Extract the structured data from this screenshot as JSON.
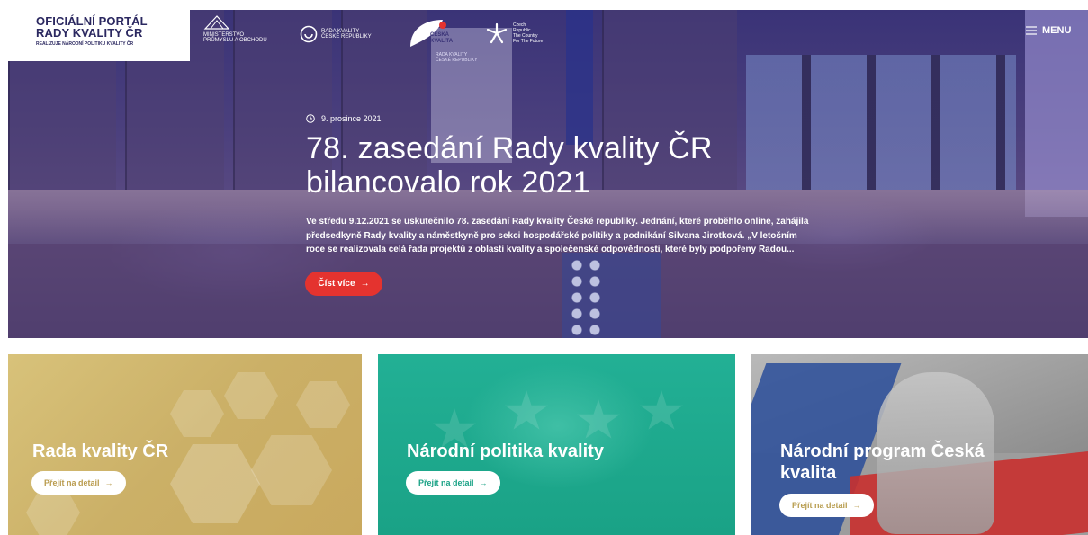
{
  "header": {
    "logo_title_line1": "OFICIÁLNÍ PORTÁL",
    "logo_title_line2": "RADY KVALITY ČR",
    "logo_subtitle": "REALIZUJE NÁRODNÍ POLITIKU KVALITY ČR",
    "partners": {
      "mpo_line1": "MINISTERSTVO",
      "mpo_line2": "PRŮMYSLU A OBCHODU",
      "rada_line1": "RADA KVALITY",
      "rada_line2": "ČESKÉ REPUBLIKY",
      "ck_line1": "ČESKÁ",
      "ck_line2": "KVALITA",
      "czech_line1": "Czech",
      "czech_line2": "Republic",
      "czech_line3": "The Country",
      "czech_line4": "For The Future"
    },
    "menu_label": "MENU",
    "banner_line1": "RADA KVALITY",
    "banner_line2": "ČESKÉ REPUBLIKY"
  },
  "hero": {
    "date": "9. prosince 2021",
    "headline": "78. zasedání Rady kvality ČR bilancovalo rok 2021",
    "lead": "Ve středu 9.12.2021 se uskutečnilo 78. zasedání Rady kvality České republiky. Jednání, které proběhlo online, zahájila předsedkyně Rady kvality a náměstkyně pro sekci hospodářské politiky a podnikání Silvana Jirotková. „V letošním roce se realizovala celá řada projektů z oblasti kvality a společenské odpovědnosti, které byly podpořeny Radou...",
    "button_label": "Číst více",
    "arrow": "→"
  },
  "cards": [
    {
      "title": "Rada kvality ČR",
      "button_label": "Přejít na detail",
      "arrow": "→"
    },
    {
      "title": "Národní politika kvality",
      "button_label": "Přejít na detail",
      "arrow": "→"
    },
    {
      "title": "Národní program Česká kvalita",
      "button_label": "Přejít na detail",
      "arrow": "→"
    }
  ],
  "colors": {
    "hero_overlay": "#3a3377",
    "accent_red": "#e4332f",
    "card1": "#cbb067",
    "card2": "#1fa98d",
    "card3": "#9d9d9d",
    "logo_text": "#2b2860"
  },
  "icons": [
    "mpo-emblem-icon",
    "rada-kvality-icon",
    "ceska-kvalita-icon",
    "czech-republic-star-icon",
    "menu-hamburger-icon",
    "clock-icon",
    "arrow-right-icon"
  ]
}
